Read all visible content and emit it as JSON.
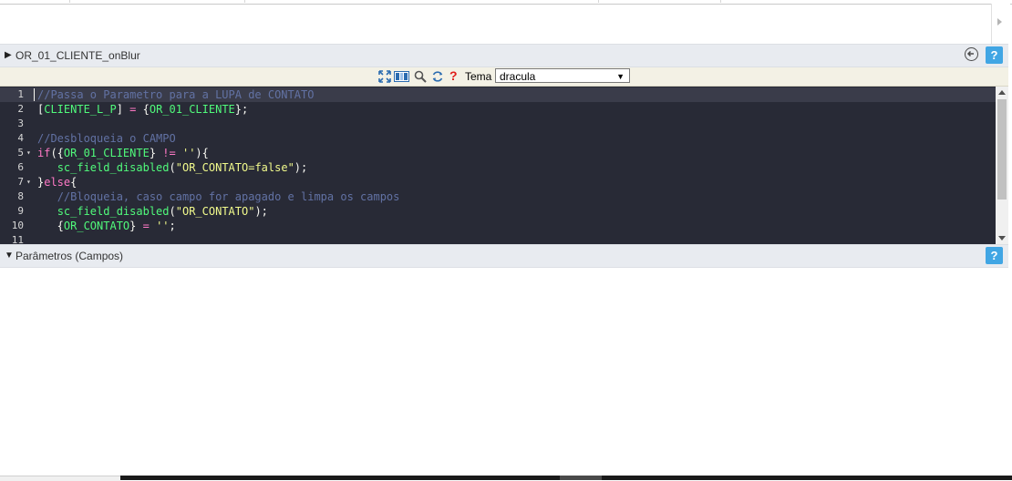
{
  "event_section": {
    "title": "OR_01_CLIENTE_onBlur",
    "expand_glyph": "▶",
    "back_icon": "circle-arrow-left-icon",
    "help_label": "?"
  },
  "toolbar": {
    "icons": [
      "fullscreen-icon",
      "columns-icon",
      "search-icon",
      "refresh-icon",
      "help-icon"
    ],
    "help_glyph": "?",
    "theme_label": "Tema",
    "theme_value": "dracula",
    "theme_caret": "▼"
  },
  "editor": {
    "theme_colors": {
      "background": "#282a36",
      "comment": "#6272a4",
      "variable": "#50fa7b",
      "keyword": "#ff79c6",
      "string": "#f1fa8c",
      "text": "#f8f8f2"
    },
    "lines": [
      {
        "n": "1",
        "fold": "",
        "tokens": [
          {
            "t": "//Passa o Parametro para a LUPA de CONTATO",
            "c": "comment"
          }
        ]
      },
      {
        "n": "2",
        "fold": "",
        "tokens": [
          {
            "t": "[",
            "c": "plain"
          },
          {
            "t": "CLIENTE_L_P",
            "c": "var"
          },
          {
            "t": "] ",
            "c": "plain"
          },
          {
            "t": "=",
            "c": "kw"
          },
          {
            "t": " {",
            "c": "plain"
          },
          {
            "t": "OR_01_CLIENTE",
            "c": "var"
          },
          {
            "t": "};",
            "c": "plain"
          }
        ]
      },
      {
        "n": "3",
        "fold": "",
        "tokens": []
      },
      {
        "n": "4",
        "fold": "",
        "tokens": [
          {
            "t": "//Desbloqueia o CAMPO",
            "c": "comment"
          }
        ]
      },
      {
        "n": "5",
        "fold": "▾",
        "tokens": [
          {
            "t": "if",
            "c": "kw"
          },
          {
            "t": "({",
            "c": "plain"
          },
          {
            "t": "OR_01_CLIENTE",
            "c": "var"
          },
          {
            "t": "} ",
            "c": "plain"
          },
          {
            "t": "!=",
            "c": "kw"
          },
          {
            "t": " ",
            "c": "plain"
          },
          {
            "t": "''",
            "c": "str"
          },
          {
            "t": "){",
            "c": "plain"
          }
        ]
      },
      {
        "n": "6",
        "fold": "",
        "tokens": [
          {
            "t": "   ",
            "c": "plain"
          },
          {
            "t": "sc_field_disabled",
            "c": "fn"
          },
          {
            "t": "(",
            "c": "plain"
          },
          {
            "t": "\"OR_CONTATO=false\"",
            "c": "str"
          },
          {
            "t": ");",
            "c": "plain"
          }
        ]
      },
      {
        "n": "7",
        "fold": "▾",
        "tokens": [
          {
            "t": "}",
            "c": "plain"
          },
          {
            "t": "else",
            "c": "kw"
          },
          {
            "t": "{",
            "c": "plain"
          }
        ]
      },
      {
        "n": "8",
        "fold": "",
        "tokens": [
          {
            "t": "   ",
            "c": "plain"
          },
          {
            "t": "//Bloqueia, caso campo for apagado e limpa os campos",
            "c": "comment"
          }
        ]
      },
      {
        "n": "9",
        "fold": "",
        "tokens": [
          {
            "t": "   ",
            "c": "plain"
          },
          {
            "t": "sc_field_disabled",
            "c": "fn"
          },
          {
            "t": "(",
            "c": "plain"
          },
          {
            "t": "\"OR_CONTATO\"",
            "c": "str"
          },
          {
            "t": ");",
            "c": "plain"
          }
        ]
      },
      {
        "n": "10",
        "fold": "",
        "tokens": [
          {
            "t": "   {",
            "c": "plain"
          },
          {
            "t": "OR_CONTATO",
            "c": "var"
          },
          {
            "t": "} ",
            "c": "plain"
          },
          {
            "t": "=",
            "c": "kw"
          },
          {
            "t": " ",
            "c": "plain"
          },
          {
            "t": "''",
            "c": "str"
          },
          {
            "t": ";",
            "c": "plain"
          }
        ]
      },
      {
        "n": "11",
        "fold": "",
        "tokens": []
      }
    ]
  },
  "params_section": {
    "title": "Parâmetros (Campos)",
    "expand_glyph": "▼",
    "help_label": "?"
  }
}
